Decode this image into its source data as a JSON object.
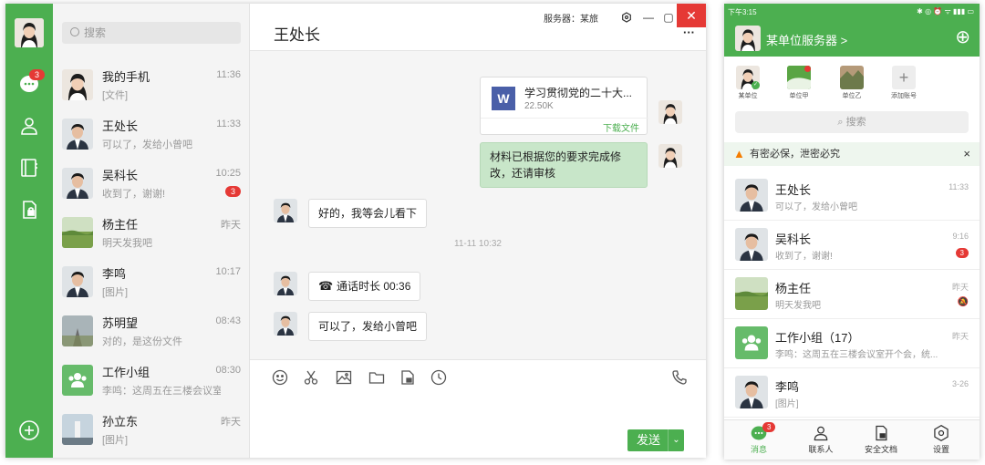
{
  "desktop": {
    "rail": {
      "badge": "3"
    },
    "search": {
      "placeholder": "搜索"
    },
    "conversations": [
      {
        "name": "我的手机",
        "preview": "[文件]",
        "time": "11:36",
        "badge": ""
      },
      {
        "name": "王处长",
        "preview": "可以了，发给小曾吧",
        "time": "11:33",
        "badge": ""
      },
      {
        "name": "吴科长",
        "preview": "收到了，谢谢!",
        "time": "10:25",
        "badge": "3"
      },
      {
        "name": "杨主任",
        "preview": "明天发我吧",
        "time": "昨天",
        "badge": ""
      },
      {
        "name": "李鸣",
        "preview": "[图片]",
        "time": "10:17",
        "badge": ""
      },
      {
        "name": "苏明望",
        "preview": "对的，是这份文件",
        "time": "08:43",
        "badge": ""
      },
      {
        "name": "工作小组",
        "preview": "李鸣：这周五在三楼会议室...",
        "time": "08:30",
        "badge": ""
      },
      {
        "name": "孙立东",
        "preview": "[图片]",
        "time": "昨天",
        "badge": ""
      }
    ],
    "chat": {
      "title": "王处长",
      "server_label": "服务器：某旅",
      "more": "···",
      "file_msg": {
        "name": "学习贯彻党的二十大...",
        "size": "22.50K",
        "action": "下载文件"
      },
      "msg_sent_text": "材料已根据您的要求完成修改，还请审核",
      "msg_reply1": "好的，我等会儿看下",
      "time_separator": "11-11 10:32",
      "call_msg": "通话时长 00:36",
      "msg_reply2": "可以了，发给小曾吧",
      "send_label": "发送",
      "send_arrow": "⌄"
    }
  },
  "phone": {
    "status_time": "下午3:15",
    "status_icons": "✱ ◎ ⏰ ᯤ ▮▮▮ ▭",
    "server": "某单位服务器 >",
    "add": "⊕",
    "accounts": [
      {
        "label": "某单位"
      },
      {
        "label": "单位甲"
      },
      {
        "label": "单位乙"
      },
      {
        "label": "添加账号"
      }
    ],
    "search": "搜索",
    "warning": "有密必保，泄密必究",
    "warning_close": "×",
    "conversations": [
      {
        "name": "王处长",
        "preview": "可以了，发给小曾吧",
        "time": "11:33",
        "badge": ""
      },
      {
        "name": "吴科长",
        "preview": "收到了，谢谢!",
        "time": "9:16",
        "badge": "3"
      },
      {
        "name": "杨主任",
        "preview": "明天发我吧",
        "time": "昨天",
        "badge": ""
      },
      {
        "name": "工作小组（17）",
        "preview": "李鸣：这周五在三楼会议室开个会，统...",
        "time": "昨天",
        "badge": ""
      },
      {
        "name": "李鸣",
        "preview": "[图片]",
        "time": "3-26",
        "badge": ""
      }
    ],
    "nav": [
      {
        "label": "消息",
        "badge": "3"
      },
      {
        "label": "联系人"
      },
      {
        "label": "安全文档"
      },
      {
        "label": "设置"
      }
    ]
  }
}
